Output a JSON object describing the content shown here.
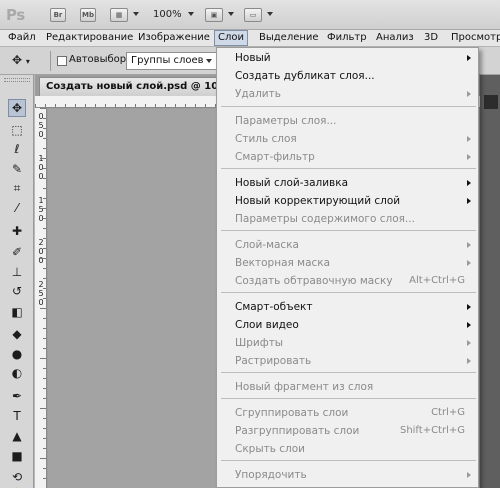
{
  "appbar": {
    "logo": "Ps",
    "bridge_label": "Br",
    "minibridge_label": "Mb",
    "zoom": "100%"
  },
  "menubar": {
    "items": [
      "Файл",
      "Редактирование",
      "Изображение",
      "Слои",
      "Выделение",
      "Фильтр",
      "Анализ",
      "3D",
      "Просмотр"
    ],
    "active_index": 3
  },
  "options": {
    "autoselect_label": "Автовыбор:",
    "autoselect_value": "Группы слоев"
  },
  "document": {
    "tab_title": "Создать новый слой.psd @ 100%",
    "ruler_left_labels": [
      "0",
      "5",
      "0",
      "1",
      "0",
      "0",
      "1",
      "5",
      "0",
      "2",
      "0",
      "0",
      "2",
      "5",
      "0"
    ]
  },
  "layer_menu": {
    "items": [
      {
        "label": "Новый",
        "shortcut": "",
        "submenu": true,
        "disabled": false
      },
      {
        "label": "Создать дубликат слоя...",
        "shortcut": "",
        "submenu": false,
        "disabled": false
      },
      {
        "label": "Удалить",
        "shortcut": "",
        "submenu": true,
        "disabled": true
      },
      {
        "label": "Параметры слоя...",
        "shortcut": "",
        "submenu": false,
        "disabled": true
      },
      {
        "label": "Стиль слоя",
        "shortcut": "",
        "submenu": true,
        "disabled": true
      },
      {
        "label": "Смарт-фильтр",
        "shortcut": "",
        "submenu": true,
        "disabled": true
      },
      {
        "label": "Новый слой-заливка",
        "shortcut": "",
        "submenu": true,
        "disabled": false
      },
      {
        "label": "Новый корректирующий слой",
        "shortcut": "",
        "submenu": true,
        "disabled": false
      },
      {
        "label": "Параметры содержимого слоя...",
        "shortcut": "",
        "submenu": false,
        "disabled": true
      },
      {
        "label": "Слой-маска",
        "shortcut": "",
        "submenu": true,
        "disabled": true
      },
      {
        "label": "Векторная маска",
        "shortcut": "",
        "submenu": true,
        "disabled": true
      },
      {
        "label": "Создать обтравочную маску",
        "shortcut": "Alt+Ctrl+G",
        "submenu": false,
        "disabled": true
      },
      {
        "label": "Смарт-объект",
        "shortcut": "",
        "submenu": true,
        "disabled": false
      },
      {
        "label": "Слои видео",
        "shortcut": "",
        "submenu": true,
        "disabled": false
      },
      {
        "label": "Шрифты",
        "shortcut": "",
        "submenu": true,
        "disabled": true
      },
      {
        "label": "Растрировать",
        "shortcut": "",
        "submenu": true,
        "disabled": true
      },
      {
        "label": "Новый фрагмент из слоя",
        "shortcut": "",
        "submenu": false,
        "disabled": true
      },
      {
        "label": "Сгруппировать слои",
        "shortcut": "Ctrl+G",
        "submenu": false,
        "disabled": true
      },
      {
        "label": "Разгруппировать слои",
        "shortcut": "Shift+Ctrl+G",
        "submenu": false,
        "disabled": true
      },
      {
        "label": "Скрыть слои",
        "shortcut": "",
        "submenu": false,
        "disabled": true
      },
      {
        "label": "Упорядочить",
        "shortcut": "",
        "submenu": true,
        "disabled": true
      }
    ]
  },
  "tools": [
    {
      "name": "move-tool-icon",
      "glyph": "✥"
    },
    {
      "name": "marquee-tool-icon",
      "glyph": "⬚"
    },
    {
      "name": "lasso-tool-icon",
      "glyph": "ℓ"
    },
    {
      "name": "quick-selection-tool-icon",
      "glyph": "✎"
    },
    {
      "name": "crop-tool-icon",
      "glyph": "⌗"
    },
    {
      "name": "eyedropper-tool-icon",
      "glyph": "⁄"
    },
    {
      "name": "healing-brush-tool-icon",
      "glyph": "✚"
    },
    {
      "name": "brush-tool-icon",
      "glyph": "✐"
    },
    {
      "name": "clone-stamp-tool-icon",
      "glyph": "⊥"
    },
    {
      "name": "history-brush-tool-icon",
      "glyph": "↺"
    },
    {
      "name": "eraser-tool-icon",
      "glyph": "◧"
    },
    {
      "name": "paint-bucket-tool-icon",
      "glyph": "◆"
    },
    {
      "name": "blur-tool-icon",
      "glyph": "●"
    },
    {
      "name": "dodge-tool-icon",
      "glyph": "◐"
    },
    {
      "name": "pen-tool-icon",
      "glyph": "✒"
    },
    {
      "name": "type-tool-icon",
      "glyph": "T"
    },
    {
      "name": "path-selection-tool-icon",
      "glyph": "▲"
    },
    {
      "name": "shape-tool-icon",
      "glyph": "■"
    },
    {
      "name": "3d-rotate-tool-icon",
      "glyph": "⟲"
    },
    {
      "name": "hand-tool-icon",
      "glyph": "✋"
    }
  ]
}
